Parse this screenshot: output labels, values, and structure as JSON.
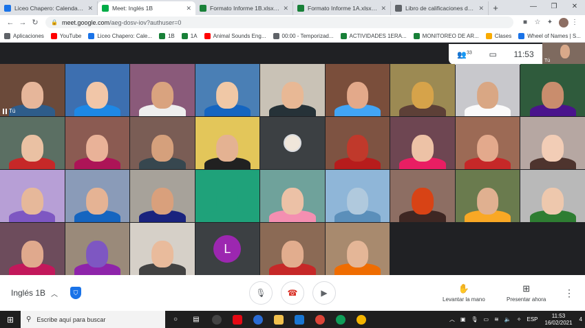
{
  "browser": {
    "tabs": [
      {
        "title": "Liceo Chapero: Calendario - m",
        "color": "#1a73e8",
        "active": false
      },
      {
        "title": "Meet: Inglés 1B",
        "color": "#00ac47",
        "active": true
      },
      {
        "title": "Formato Informe 1B.xlsx - Hoja",
        "color": "#188038",
        "active": false
      },
      {
        "title": "Formato Informe 1A.xlsx - Hoja",
        "color": "#188038",
        "active": false
      },
      {
        "title": "Libro de calificaciones de Soc",
        "color": "#5f6368",
        "active": false
      }
    ],
    "new_tab": "+",
    "url_host": "meet.google.com",
    "url_path": "/aeg-dosv-iov?authuser=0",
    "bookmarks": [
      {
        "label": "Aplicaciones",
        "color": "#5f6368"
      },
      {
        "label": "YouTube",
        "color": "#ff0000"
      },
      {
        "label": "Liceo Chapero: Cale...",
        "color": "#1a73e8"
      },
      {
        "label": "1B",
        "color": "#188038"
      },
      {
        "label": "1A",
        "color": "#188038"
      },
      {
        "label": "Animal Sounds Eng...",
        "color": "#ff0000"
      },
      {
        "label": "00:00 - Temporizad...",
        "color": "#5f6368"
      },
      {
        "label": "ACTIVIDADES 1ERA...",
        "color": "#188038"
      },
      {
        "label": "MONITOREO DE AR...",
        "color": "#188038"
      },
      {
        "label": "Clases",
        "color": "#f9ab00"
      },
      {
        "label": "Wheel of Names | S...",
        "color": "#1a73e8"
      }
    ],
    "bookmarks_more": "»"
  },
  "meet": {
    "participant_count": "33",
    "time": "11:53",
    "self_label": "Tú",
    "tile_you_label": "Tú",
    "avatar_letter": "L",
    "meeting_name": "Inglés 1B",
    "raise_hand_label": "Levantar la mano",
    "present_label": "Presentar ahora",
    "tiles": [
      {
        "bg": "#6b4a3a",
        "skin": "#e6b69a",
        "shirt": "#2e5c8a",
        "you": true
      },
      {
        "bg": "#3d6fb0",
        "skin": "#f1c6a8",
        "shirt": "#1e88e5"
      },
      {
        "bg": "#8a5a7a",
        "skin": "#d9a37f",
        "shirt": "#eeeeee"
      },
      {
        "bg": "#4a7fb5",
        "skin": "#f0c8a6",
        "shirt": "#1565c0"
      },
      {
        "bg": "#c9c2b6",
        "skin": "#e8b895",
        "shirt": "#263238"
      },
      {
        "bg": "#7a4e3b",
        "skin": "#e3a98a",
        "shirt": "#42a5f5"
      },
      {
        "bg": "#9c8a53",
        "skin": "#d6a34a",
        "shirt": "#5d4037"
      },
      {
        "bg": "#c8c8cc",
        "skin": "#d9a784",
        "shirt": "#fafafa"
      },
      {
        "bg": "#2f5b3c",
        "skin": "#c98d6d",
        "shirt": "#4a148c"
      },
      {
        "bg": "#5b6f63",
        "skin": "#eac1a3",
        "shirt": "#c62828"
      },
      {
        "bg": "#8b5b52",
        "skin": "#e9b298",
        "shirt": "#ad1457"
      },
      {
        "bg": "#7a5d55",
        "skin": "#d5a07c",
        "shirt": "#37474f"
      },
      {
        "bg": "#e3c65a",
        "skin": "#e4b292",
        "shirt": "#212121"
      },
      {
        "avatar": true
      },
      {
        "bg": "#7e5342",
        "skin": "#c0392b",
        "shirt": "#b71c1c"
      },
      {
        "bg": "#6e4652",
        "skin": "#edc2a6",
        "shirt": "#e91e63"
      },
      {
        "bg": "#9c6a55",
        "skin": "#e3a98c",
        "shirt": "#c62828"
      },
      {
        "bg": "#b6a7a2",
        "skin": "#f2cdb6",
        "shirt": "#4e342e"
      },
      {
        "bg": "#b79fd6",
        "skin": "#e6b89a",
        "shirt": "#7e57c2"
      },
      {
        "bg": "#8a9bb8",
        "skin": "#e5b394",
        "shirt": "#1565c0"
      },
      {
        "bg": "#a7a29a",
        "skin": "#d9a07c",
        "shirt": "#1a237e"
      },
      {
        "bg": "#1fa27a",
        "skin": "#1fa27a",
        "shirt": "#1fa27a"
      },
      {
        "bg": "#6fa29b",
        "skin": "#ecc1a6",
        "shirt": "#f48fb1"
      },
      {
        "bg": "#8fb6d8",
        "skin": "#b0c9dd",
        "shirt": "#5b8fba"
      },
      {
        "bg": "#8d6e63",
        "skin": "#d84315",
        "shirt": "#3e2723"
      },
      {
        "bg": "#6a7b4e",
        "skin": "#e0b090",
        "shirt": "#f9a825"
      },
      {
        "bg": "#b9b9b9",
        "skin": "#eec8ad",
        "shirt": "#2e7d32"
      },
      {
        "bg": "#6d4c5c",
        "skin": "#e0a98d",
        "shirt": "#c2185b"
      },
      {
        "bg": "#9a8a7a",
        "skin": "#7e57c2",
        "shirt": "#8e24aa"
      },
      {
        "bg": "#d6d0c8",
        "skin": "#e9bb9c",
        "shirt": "#424242"
      },
      {
        "letter": true
      },
      {
        "bg": "#8b6a55",
        "skin": "#e2ad8e",
        "shirt": "#c62828"
      },
      {
        "bg": "#a88a6e",
        "skin": "#e4b697",
        "shirt": "#ef6c00"
      },
      {
        "empty": true
      }
    ]
  },
  "taskbar": {
    "search_placeholder": "Escribe aquí para buscar",
    "language": "ESP",
    "clock_time": "11:53",
    "clock_date": "16/02/2021",
    "notifications": "4"
  }
}
